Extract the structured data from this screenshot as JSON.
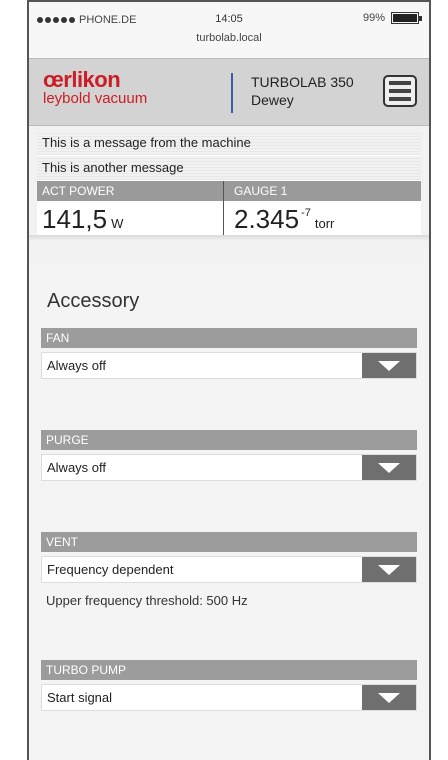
{
  "status_bar": {
    "carrier": "PHONE.DE",
    "time": "14:05",
    "url": "turbolab.local",
    "battery": "99%"
  },
  "header": {
    "logo_main": "œrlikon",
    "logo_sub": "leybold vacuum",
    "device_model": "TURBOLAB 350",
    "device_name": "Dewey",
    "menu_icon": "hamburger-menu-icon"
  },
  "messages": [
    "This is a message from the machine",
    "This is another message"
  ],
  "readouts": [
    {
      "label": "ACT POWER",
      "value": "141,5",
      "unit": "W"
    },
    {
      "label": "GAUGE 1",
      "value": "2.345",
      "exponent": "-7",
      "unit": "torr"
    }
  ],
  "accessory": {
    "title": "Accessory",
    "groups": [
      {
        "label": "FAN",
        "value": "Always off"
      },
      {
        "label": "PURGE",
        "value": "Always off"
      },
      {
        "label": "VENT",
        "value": "Frequency dependent",
        "note": "Upper frequency threshold: 500 Hz"
      },
      {
        "label": "TURBO PUMP",
        "value": "Start signal"
      }
    ]
  },
  "colors": {
    "brand_red": "#cc1d24",
    "label_gray": "#9c9c9c",
    "dropdown_gray": "#6f6f6f",
    "divider_blue": "#3a5f9e"
  }
}
